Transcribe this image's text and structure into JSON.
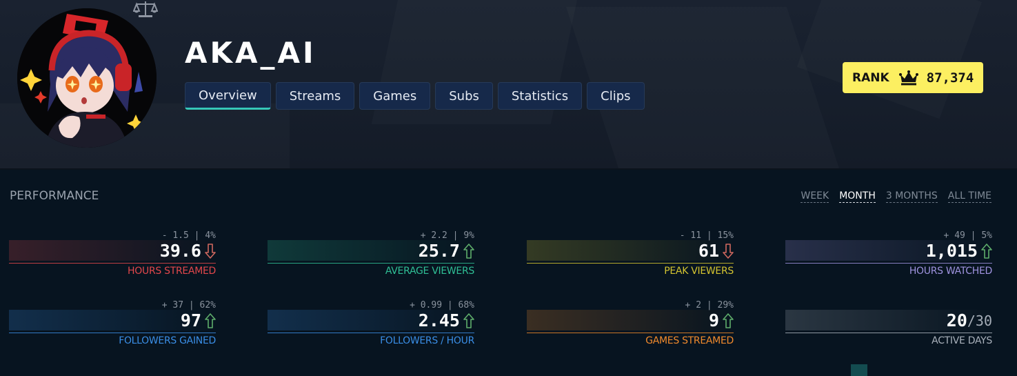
{
  "channel": {
    "name": "AKA_AI"
  },
  "tabs": [
    {
      "label": "Overview",
      "active": true
    },
    {
      "label": "Streams",
      "active": false
    },
    {
      "label": "Games",
      "active": false
    },
    {
      "label": "Subs",
      "active": false
    },
    {
      "label": "Statistics",
      "active": false
    },
    {
      "label": "Clips",
      "active": false
    }
  ],
  "rank": {
    "label": "RANK",
    "icon": "crown-icon",
    "value": "87,374",
    "color": "#fcef61"
  },
  "performance": {
    "title": "PERFORMANCE",
    "periods": [
      {
        "label": "WEEK",
        "active": false
      },
      {
        "label": "MONTH",
        "active": true
      },
      {
        "label": "3 MONTHS",
        "active": false
      },
      {
        "label": "ALL TIME",
        "active": false
      }
    ],
    "stats": [
      {
        "label": "HOURS STREAMED",
        "value": "39.6",
        "delta": "- 1.5 | 4%",
        "trend": "down",
        "color": "#e2474b"
      },
      {
        "label": "AVERAGE VIEWERS",
        "value": "25.7",
        "delta": "+ 2.2 | 9%",
        "trend": "up",
        "color": "#2fbf95"
      },
      {
        "label": "PEAK VIEWERS",
        "value": "61",
        "delta": "- 11 | 15%",
        "trend": "down",
        "color": "#d4c430"
      },
      {
        "label": "HOURS WATCHED",
        "value": "1,015",
        "delta": "+ 49 | 5%",
        "trend": "up",
        "color": "#9f93df"
      },
      {
        "label": "FOLLOWERS GAINED",
        "value": "97",
        "delta": "+ 37 | 62%",
        "trend": "up",
        "color": "#3a8ee6"
      },
      {
        "label": "FOLLOWERS / HOUR",
        "value": "2.45",
        "delta": "+ 0.99 | 68%",
        "trend": "up",
        "color": "#3a8ee6"
      },
      {
        "label": "GAMES STREAMED",
        "value": "9",
        "delta": "+ 2 | 29%",
        "trend": "up",
        "color": "#f08a2c"
      },
      {
        "label": "ACTIVE DAYS",
        "value": "20",
        "value_sub": "/30",
        "delta": "",
        "trend": "none",
        "color": "#a9b1bb"
      }
    ]
  },
  "colors": {
    "up_arrow": "#5fae6b",
    "down_arrow": "#d0685f",
    "tab_active_underline": "#35c7b8"
  }
}
